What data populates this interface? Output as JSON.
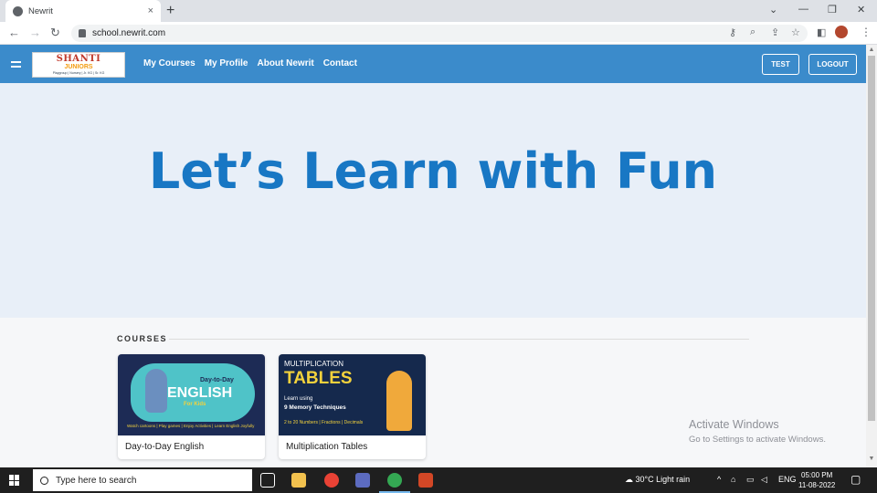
{
  "browser": {
    "tab_title": "Newrit",
    "tab_close": "×",
    "new_tab": "+",
    "minimize": "⌄",
    "window_min": "—",
    "window_restore": "❐",
    "window_close": "✕",
    "url": "school.newrit.com",
    "back": "←",
    "forward": "→",
    "reload": "↻"
  },
  "site": {
    "logo": {
      "line1": "SHANTI",
      "line2": "JUNIORS",
      "line3": "Playgroup | Nursery | Jr. KG | Sr. KG"
    },
    "nav": [
      "My Courses",
      "My Profile",
      "About Newrit",
      "Contact"
    ],
    "test_button": "TEST",
    "logout_button": "LOGOUT"
  },
  "hero": {
    "title": "Let’s Learn with Fun"
  },
  "courses": {
    "heading": "COURSES",
    "items": [
      {
        "title": "Day-to-Day English",
        "thumb": {
          "tag": "Day-to-Day",
          "big": "ENGLISH",
          "sub": "For Kids",
          "footer": "Watch cartoons | Play games | Enjoy Activities | Learn English Joyfully"
        }
      },
      {
        "title": "Multiplication Tables",
        "thumb": {
          "line1": "MULTIPLICATION",
          "line2": "TABLES",
          "line3": "Learn using",
          "line4": "9 Memory Techniques",
          "line5": "2 to 20 Numbers | Fractions | Decimals"
        }
      }
    ]
  },
  "watermark": {
    "title": "Activate Windows",
    "subtitle": "Go to Settings to activate Windows."
  },
  "taskbar": {
    "search_placeholder": "Type here to search",
    "weather": "30°C  Light rain",
    "language": "ENG",
    "time": "05:00 PM",
    "date": "11-08-2022"
  },
  "colors": {
    "nav_bar": "#3b8bcb",
    "hero_title": "#1877c4",
    "hero_bg": "#e8eff8"
  }
}
